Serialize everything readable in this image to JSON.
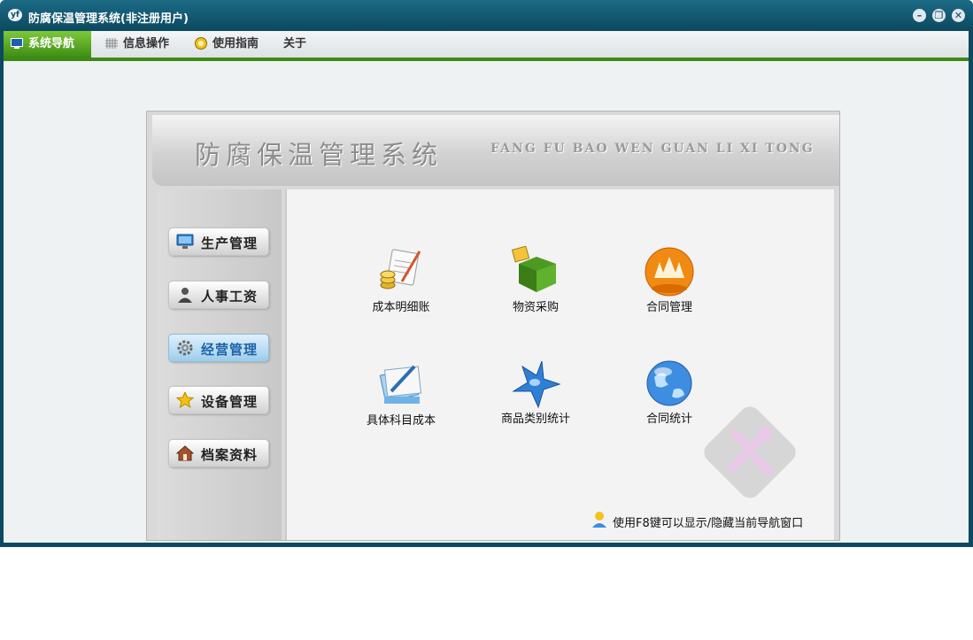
{
  "window": {
    "title": "防腐保温管理系统(非注册用户)",
    "app_icon": "yf-logo-icon"
  },
  "window_controls": {
    "minimize": "minimize-icon",
    "restore": "restore-icon",
    "close": "close-icon"
  },
  "menu": {
    "items": [
      {
        "label": "系统导航",
        "icon": "monitor-icon",
        "active": true
      },
      {
        "label": "信息操作",
        "icon": "grid-icon",
        "active": false
      },
      {
        "label": "使用指南",
        "icon": "help-icon",
        "active": false
      },
      {
        "label": "关于",
        "icon": "",
        "active": false
      }
    ]
  },
  "banner": {
    "title_cn": "防腐保温管理系统",
    "title_en": "FANG FU BAO  WEN GUAN LI XI TONG"
  },
  "sidebar": {
    "items": [
      {
        "label": "生产管理",
        "icon": "monitor-icon",
        "active": false
      },
      {
        "label": "人事工资",
        "icon": "person-icon",
        "active": false
      },
      {
        "label": "经营管理",
        "icon": "gear-icon",
        "active": true
      },
      {
        "label": "设备管理",
        "icon": "star-icon",
        "active": false
      },
      {
        "label": "档案资料",
        "icon": "house-icon",
        "active": false
      }
    ]
  },
  "modules": [
    {
      "label": "成本明细账",
      "icon": "ledger-coins-icon"
    },
    {
      "label": "物资采购",
      "icon": "green-blocks-icon"
    },
    {
      "label": "合同管理",
      "icon": "orange-flame-icon"
    },
    {
      "label": "具体科目成本",
      "icon": "document-pen-icon"
    },
    {
      "label": "商品类别统计",
      "icon": "blue-star-icon"
    },
    {
      "label": "合同统计",
      "icon": "blue-globe-icon"
    }
  ],
  "hint": {
    "text": "使用F8键可以显示/隐藏当前导航窗口",
    "icon": "user-hint-icon"
  },
  "watermark_icon": "tools-watermark-icon",
  "colors": {
    "title_bar": "#0c4a60",
    "menu_active": "#5aaa25",
    "menu_underline": "#3d8a16",
    "sidebar_active": "#b7dcf3"
  }
}
